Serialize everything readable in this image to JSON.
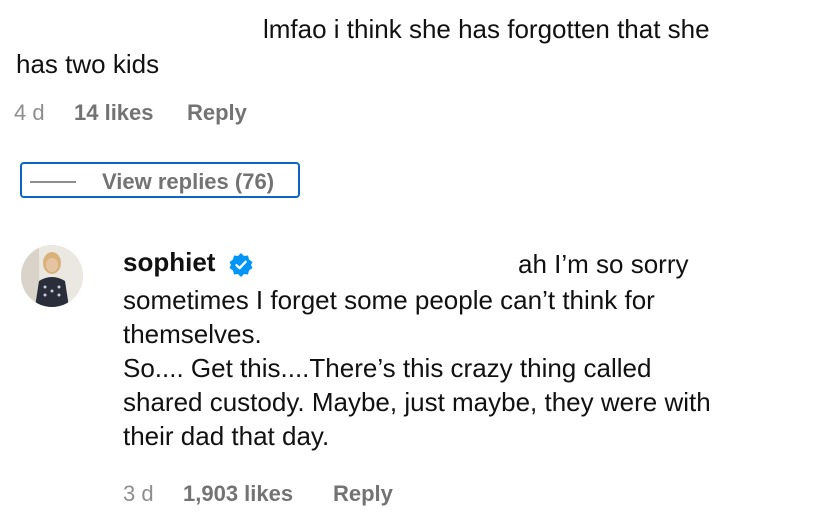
{
  "comment1": {
    "text_line1": "lmfao i think she has forgotten that she",
    "text_line2": "has two kids",
    "time": "4 d",
    "likes": "14 likes",
    "reply": "Reply",
    "view_replies": "View replies (76)"
  },
  "comment2": {
    "username": "sophiet",
    "verified_icon": "verified-badge-icon",
    "lead_text": "ah I’m so sorry",
    "lines": [
      "sometimes I forget some people can’t think for",
      "themselves.",
      "So.... Get this....There’s this crazy thing called",
      "shared custody. Maybe, just maybe, they were with",
      "their dad that day."
    ],
    "time": "3 d",
    "likes": "1,903 likes",
    "reply": "Reply"
  },
  "colors": {
    "text": "#111111",
    "meta": "#8e8e8e",
    "focus_outline": "#0a66c2",
    "verified": "#0095f6"
  }
}
